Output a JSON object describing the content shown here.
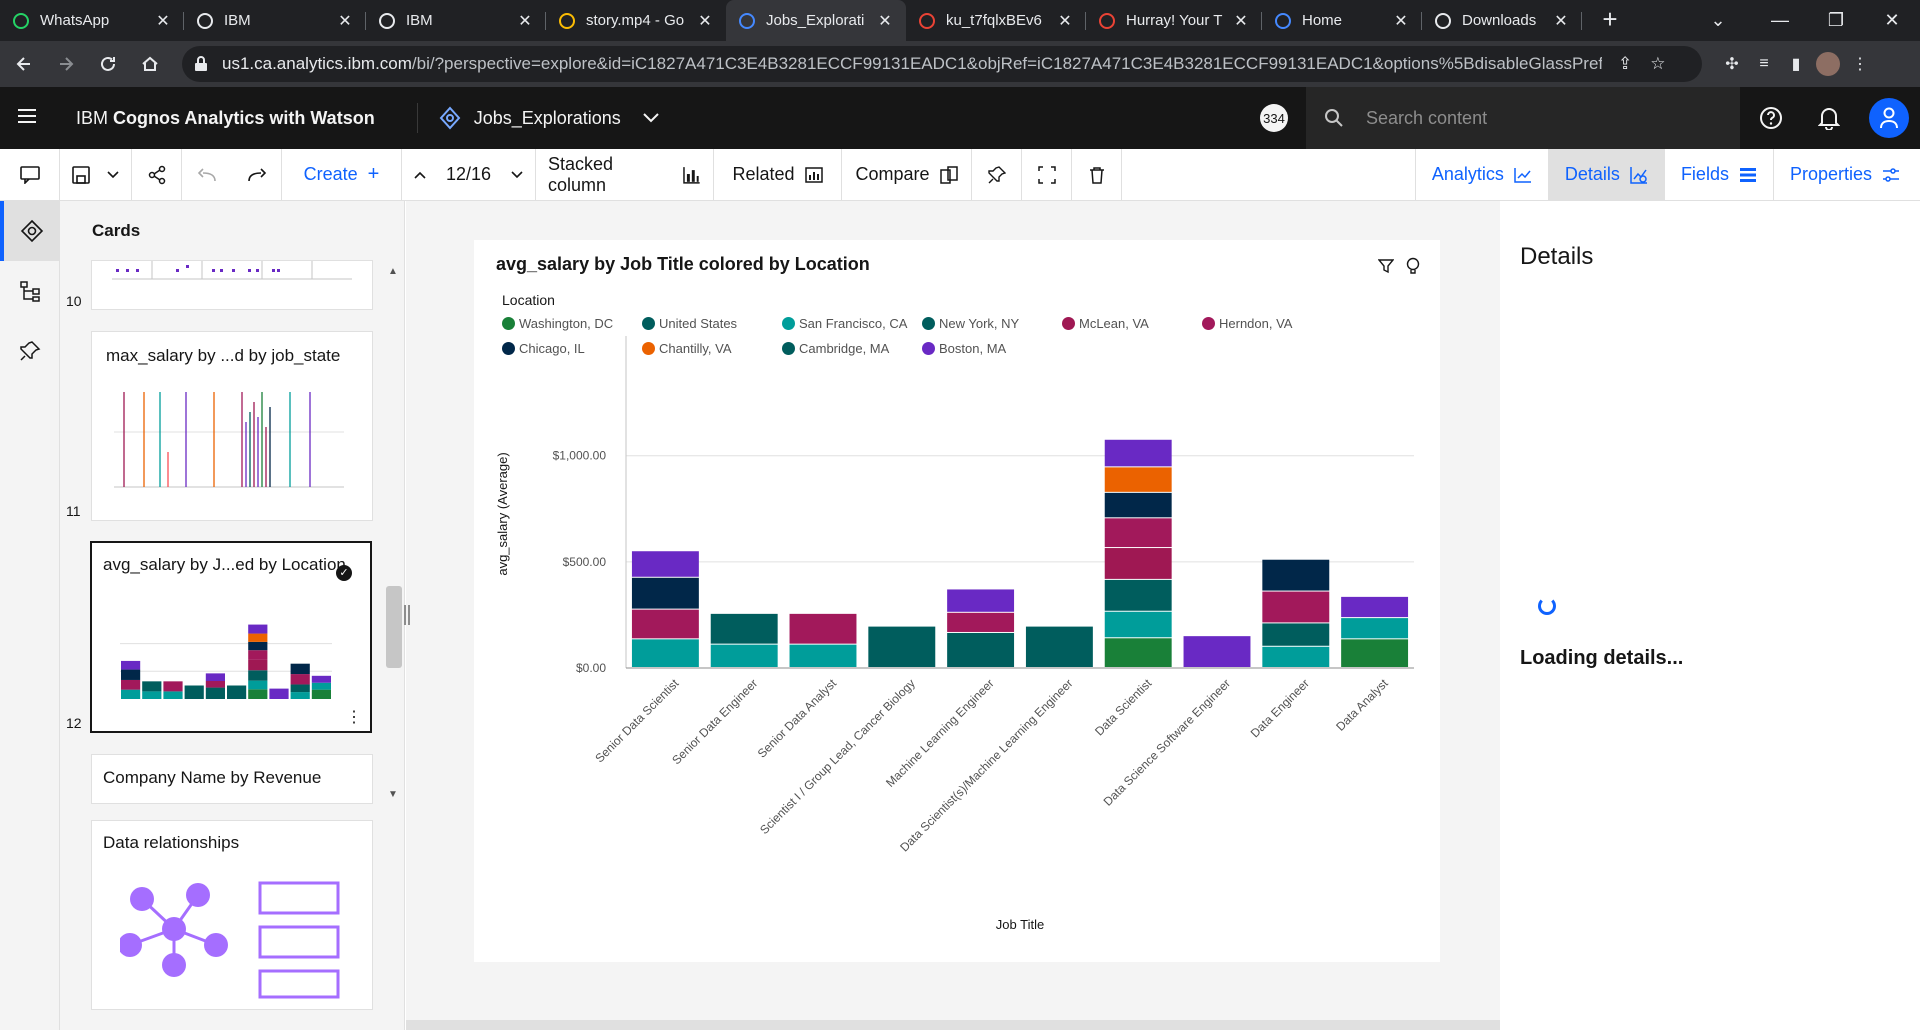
{
  "browser": {
    "tabs": [
      {
        "title": "WhatsApp",
        "icon": "whatsapp-icon",
        "color": "#25d366"
      },
      {
        "title": "IBM",
        "icon": "globe-icon",
        "color": "#e8eaed"
      },
      {
        "title": "IBM",
        "icon": "globe-icon",
        "color": "#e8eaed"
      },
      {
        "title": "story.mp4 - Go",
        "icon": "drive-icon",
        "color": "#fbbc04"
      },
      {
        "title": "Jobs_Explorati",
        "icon": "cognos-icon",
        "color": "#4589ff"
      },
      {
        "title": "ku_t7fqlxBEv6",
        "icon": "pinwheel-icon",
        "color": "#ea4335"
      },
      {
        "title": "Hurray! Your T",
        "icon": "gmail-icon",
        "color": "#ea4335"
      },
      {
        "title": "Home",
        "icon": "cognos-icon",
        "color": "#4589ff"
      },
      {
        "title": "Downloads",
        "icon": "download-icon",
        "color": "#e8eaed"
      }
    ],
    "url_host": "us1.ca.analytics.ibm.com",
    "url_rest": "/bi/?perspective=explore&id=iC1827A471C3E4B3281ECCF99131EADC1&objRef=iC1827A471C3E4B3281ECCF99131EADC1&options%5BdisableGlassPrefet..."
  },
  "app": {
    "brand_prefix": "IBM ",
    "brand_name": "Cognos Analytics with Watson",
    "exploration_name": "Jobs_Explorations",
    "notification_count": "334",
    "search_placeholder": "Search content"
  },
  "toolbar": {
    "create_label": "Create",
    "page_indicator": "12/16",
    "chart_type_label": "Stacked column",
    "related_label": "Related",
    "compare_label": "Compare",
    "analytics_tab": "Analytics",
    "details_tab": "Details",
    "fields_tab": "Fields",
    "properties_tab": "Properties"
  },
  "cards_panel": {
    "heading": "Cards",
    "cards": [
      {
        "number": "10",
        "title": ""
      },
      {
        "number": "11",
        "title": "max_salary by ...d by job_state"
      },
      {
        "number": "12",
        "title": "avg_salary by J...ed by Location"
      },
      {
        "number": "",
        "title": "Company Name by Revenue"
      },
      {
        "number": "",
        "title": "Data relationships"
      }
    ]
  },
  "details_panel": {
    "title": "Details",
    "loading_text": "Loading details..."
  },
  "chart_data": {
    "type": "bar",
    "stacked": true,
    "title": "avg_salary by Job Title colored by Location",
    "xlabel": "Job Title",
    "ylabel": "avg_salary (Average)",
    "legend_title": "Location",
    "legend_position": "top-left",
    "ylim": [
      0,
      1300
    ],
    "yticks": [
      {
        "value": 0,
        "label": "$0.00"
      },
      {
        "value": 500,
        "label": "$500.00"
      },
      {
        "value": 1000,
        "label": "$1,000.00"
      }
    ],
    "grid": true,
    "categories": [
      "Senior Data Scientist",
      "Senior Data Engineer",
      "Senior Data Analyst",
      "Scientist I / Group Lead, Cancer Biology",
      "Machine Learning Engineer",
      "Data Scientist(s)/Machine Learning Engineer",
      "Data Scientist",
      "Data Science Software Engineer",
      "Data Engineer",
      "Data Analyst"
    ],
    "series": [
      {
        "name": "Washington, DC",
        "color": "#198038",
        "values": [
          0,
          0,
          0,
          0,
          0,
          0,
          140,
          0,
          0,
          135
        ]
      },
      {
        "name": "United States",
        "color": "#005d5d",
        "values": [
          0,
          0,
          0,
          0,
          0,
          0,
          0,
          0,
          0,
          0
        ]
      },
      {
        "name": "San Francisco, CA",
        "color": "#009d9a",
        "values": [
          135,
          110,
          110,
          0,
          0,
          0,
          125,
          0,
          100,
          100
        ]
      },
      {
        "name": "New York, NY",
        "color": "#005d5d",
        "values": [
          0,
          0,
          0,
          195,
          165,
          195,
          0,
          0,
          0,
          0
        ]
      },
      {
        "name": "McLean, VA",
        "color": "#9f1853",
        "values": [
          0,
          0,
          0,
          0,
          0,
          0,
          150,
          0,
          0,
          0
        ]
      },
      {
        "name": "Herndon, VA",
        "color": "#a2195b",
        "values": [
          140,
          0,
          145,
          0,
          95,
          0,
          140,
          0,
          150,
          0
        ]
      },
      {
        "name": "Chicago, IL",
        "color": "#012749",
        "values": [
          150,
          0,
          0,
          0,
          0,
          0,
          120,
          0,
          150,
          0
        ]
      },
      {
        "name": "Chantilly, VA",
        "color": "#eb6200",
        "values": [
          0,
          0,
          0,
          0,
          0,
          0,
          120,
          0,
          0,
          0
        ]
      },
      {
        "name": "Cambridge, MA",
        "color": "#005d5d",
        "values": [
          0,
          145,
          0,
          0,
          0,
          0,
          150,
          0,
          110,
          0
        ]
      },
      {
        "name": "Boston, MA",
        "color": "#6929c4",
        "values": [
          125,
          0,
          0,
          0,
          110,
          0,
          130,
          150,
          0,
          100
        ]
      }
    ],
    "segments_order_note_hidden": ""
  }
}
